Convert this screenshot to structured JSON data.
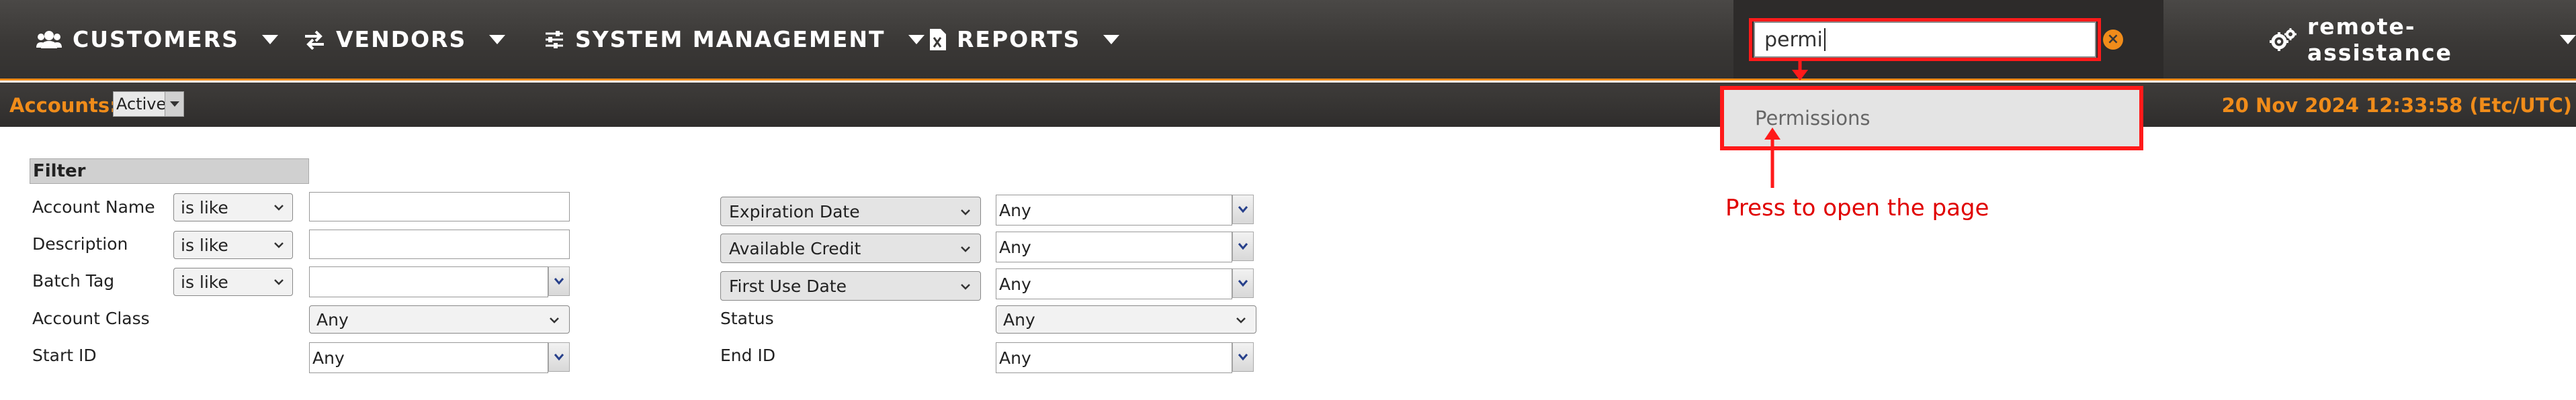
{
  "nav": {
    "customers": "CUSTOMERS",
    "vendors": "VENDORS",
    "system": "SYSTEM MANAGEMENT",
    "reports": "REPORTS",
    "user": "remote-assistance"
  },
  "search": {
    "value": "permi"
  },
  "suggestion": {
    "item": "Permissions"
  },
  "annotation": "Press to open the page",
  "subbar": {
    "accounts_label": "Accounts:",
    "status_value": "Active",
    "datetime": "20 Nov 2024 12:33:58 (Etc/UTC)"
  },
  "filter": {
    "title": "Filter",
    "rows": [
      {
        "label": "Account Name",
        "op": "is like"
      },
      {
        "label": "Description",
        "op": "is like"
      },
      {
        "label": "Batch Tag",
        "op": "is like"
      },
      {
        "label": "Account Class",
        "value": "Any"
      },
      {
        "label": "Start ID",
        "value": "Any"
      }
    ],
    "right": [
      {
        "field": "Expiration Date",
        "value": "Any"
      },
      {
        "field": "Available Credit",
        "value": "Any"
      },
      {
        "field": "First Use Date",
        "value": "Any"
      },
      {
        "label": "Status",
        "value": "Any"
      },
      {
        "label": "End ID",
        "value": "Any"
      }
    ]
  },
  "colors": {
    "accent": "#f08c1a",
    "nav_bg": "#3a3836",
    "highlight": "#ff1a1a"
  },
  "icons": [
    "users-icon",
    "exchange-icon",
    "sliders-icon",
    "file-excel-icon",
    "gears-icon",
    "caret-down-icon",
    "clear-icon"
  ]
}
